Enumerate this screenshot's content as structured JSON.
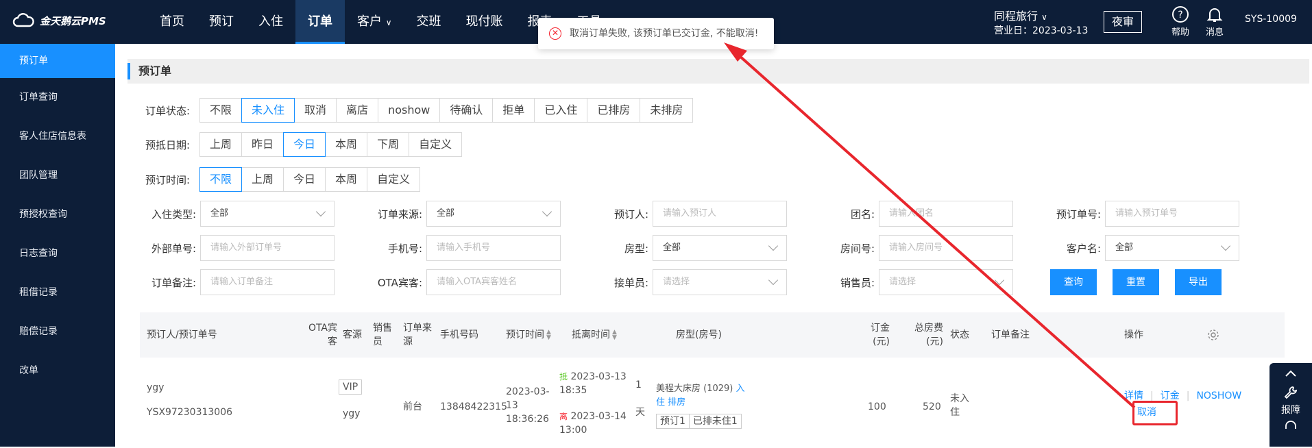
{
  "header": {
    "logo": "金天鹅云PMS",
    "nav": [
      "首页",
      "预订",
      "入住",
      "订单",
      "客户",
      "交班",
      "现付账",
      "报表",
      "工具"
    ],
    "nav_active": 3,
    "nav_dropdown": [
      4
    ],
    "hotel": "同程旅行",
    "business_date": "营业日：2023-03-13",
    "night_audit": "夜审",
    "help": "帮助",
    "messages": "消息",
    "user": "SYS-10009"
  },
  "sidebar": {
    "items": [
      "预订单",
      "订单查询",
      "客人住店信息表",
      "团队管理",
      "预授权查询",
      "日志查询",
      "租借记录",
      "赔偿记录",
      "改单"
    ],
    "active": 0
  },
  "page": {
    "title": "预订单"
  },
  "filters": {
    "status": {
      "label": "订单状态:",
      "options": [
        "不限",
        "未入住",
        "取消",
        "离店",
        "noshow",
        "待确认",
        "拒单",
        "已入住",
        "已排房",
        "未排房"
      ],
      "active": 1
    },
    "date": {
      "label": "预抵日期:",
      "options": [
        "上周",
        "昨日",
        "今日",
        "本周",
        "下周",
        "自定义"
      ],
      "active": 2
    },
    "booktime": {
      "label": "预订时间:",
      "options": [
        "不限",
        "上周",
        "今日",
        "本周",
        "自定义"
      ],
      "active": 0
    }
  },
  "fields": {
    "checkin_type": {
      "label": "入住类型:",
      "value": "全部"
    },
    "order_source": {
      "label": "订单来源:",
      "value": "全部"
    },
    "booker": {
      "label": "预订人:",
      "placeholder": "请输入预订人"
    },
    "group": {
      "label": "团名:",
      "placeholder": "请输入团名"
    },
    "order_no": {
      "label": "预订单号:",
      "placeholder": "请输入预订单号"
    },
    "external_no": {
      "label": "外部单号:",
      "placeholder": "请输入外部订单号"
    },
    "phone": {
      "label": "手机号:",
      "placeholder": "请输入手机号"
    },
    "room_type": {
      "label": "房型:",
      "value": "全部"
    },
    "room_no": {
      "label": "房间号:",
      "placeholder": "请输入房间号"
    },
    "customer": {
      "label": "客户名:",
      "value": "全部"
    },
    "remark": {
      "label": "订单备注:",
      "placeholder": "请输入订单备注"
    },
    "ota_guest": {
      "label": "OTA宾客:",
      "placeholder": "请输入OTA宾客姓名"
    },
    "receiver": {
      "label": "接单员:",
      "placeholder": "请选择"
    },
    "sales": {
      "label": "销售员:",
      "placeholder": "请选择"
    }
  },
  "actions": {
    "query": "查询",
    "reset": "重置",
    "export": "导出"
  },
  "table": {
    "headers": {
      "booker": "预订人/预订单号",
      "ota1": "OTA宾",
      "ota2": "客",
      "source": "客源",
      "sales1": "销售",
      "sales2": "员",
      "origin1": "订单来",
      "origin2": "源",
      "phone": "手机号码",
      "booktime": "预订时间",
      "stay": "抵离时间",
      "room": "房型(房号)",
      "deposit1": "订金",
      "deposit2": "(元)",
      "total1": "总房费",
      "total2": "(元)",
      "status": "状态",
      "remark": "订单备注",
      "op": "操作"
    },
    "row": {
      "booker": "ygy",
      "order_no": "YSX97230313006",
      "vip": "VIP",
      "source": "ygy",
      "origin": "前台",
      "phone": "13848422315",
      "booktime1": "2023-03-",
      "booktime2": "13",
      "booktime3": "18:36:26",
      "arrive_tag": "抵",
      "arrive1": "2023-03-13",
      "arrive2": "18:35",
      "leave_tag": "离",
      "leave1": "2023-03-14",
      "leave2": "13:00",
      "nights1": "1",
      "nights2": "天",
      "room": "美程大床房 (1029)",
      "checkin_link1": "入",
      "checkin_link2": "住",
      "assign_link": "排房",
      "tag1": "预订1",
      "tag2": "已排未住1",
      "deposit": "100",
      "total": "520",
      "status1": "未入",
      "status2": "住",
      "op_detail": "详情",
      "op_deposit": "订金",
      "op_noshow": "NOSHOW",
      "op_cancel": "取消"
    }
  },
  "toast": {
    "message": "取消订单失败, 该预订单已交订金, 不能取消!"
  },
  "float": {
    "report": "报障"
  },
  "colors": {
    "nav_bg": "#0d1e38",
    "accent": "#1890ff",
    "annotation": "#e8262d"
  }
}
